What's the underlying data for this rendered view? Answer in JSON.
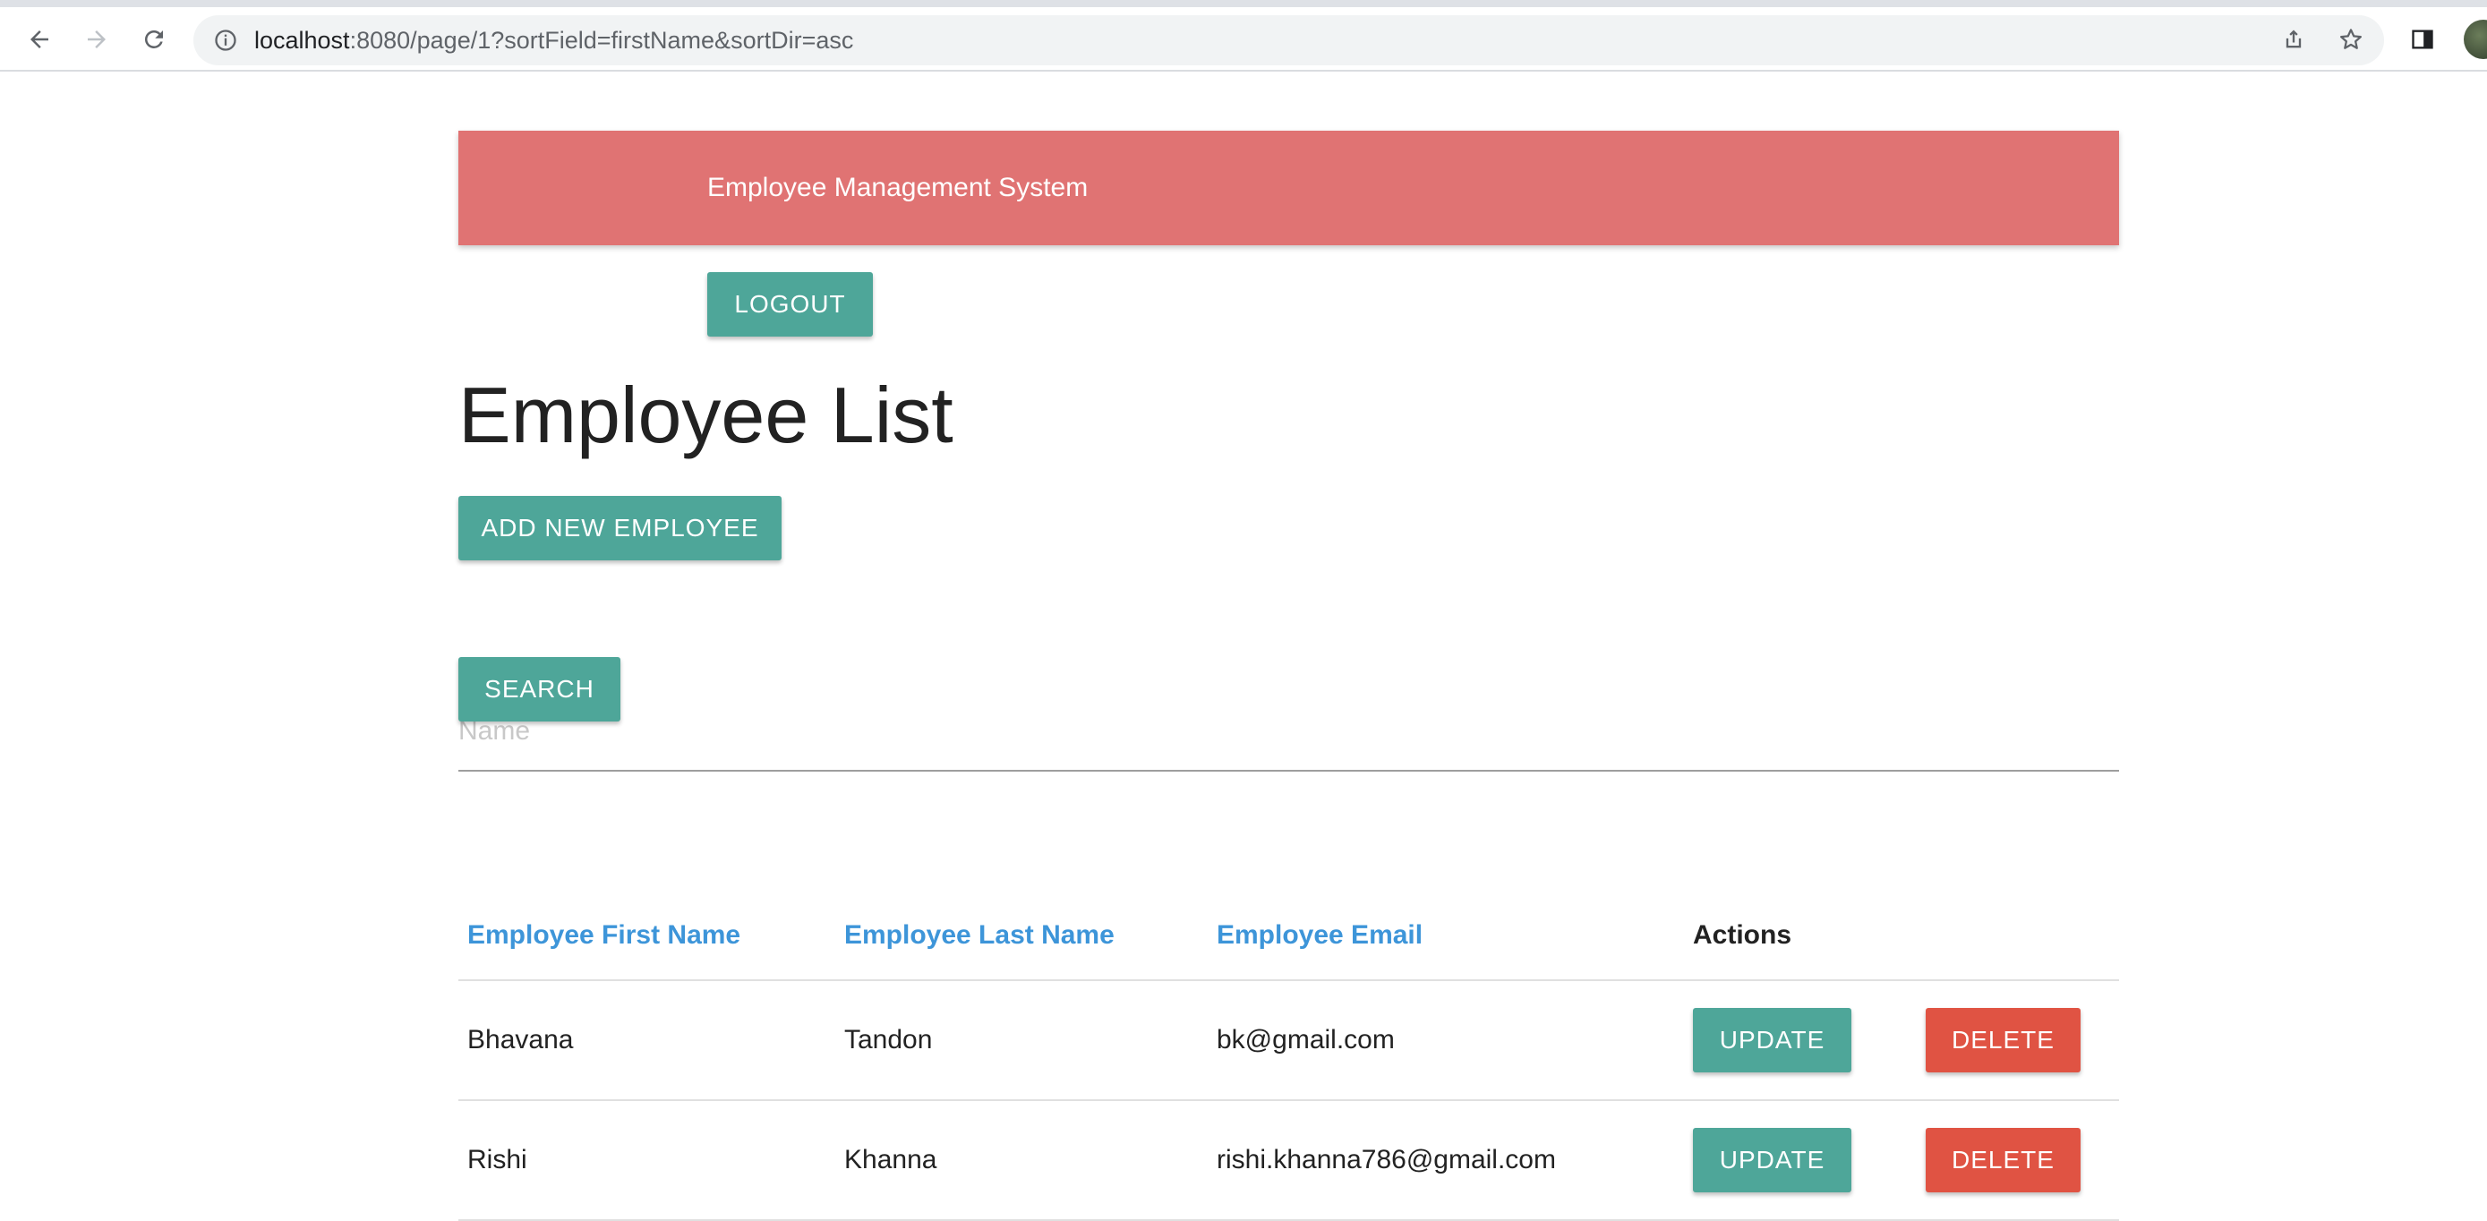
{
  "browser": {
    "url_host": "localhost",
    "url_rest": ":8080/page/1?sortField=firstName&sortDir=asc",
    "icons": [
      "back-arrow-icon",
      "forward-arrow-icon",
      "reload-icon",
      "info-icon",
      "share-icon",
      "star-icon",
      "side-panel-icon"
    ]
  },
  "navbar": {
    "brand": "Employee Management System"
  },
  "auth": {
    "logout_label": "LOGOUT"
  },
  "page": {
    "title": "Employee List",
    "add_button_label": "ADD NEW EMPLOYEE",
    "search_placeholder": "Name",
    "search_value": "",
    "search_button_label": "SEARCH"
  },
  "table": {
    "headers": {
      "first_name": "Employee First Name",
      "last_name": "Employee Last Name",
      "email": "Employee Email",
      "actions": "Actions"
    },
    "rows": [
      {
        "first_name": "Bhavana",
        "last_name": "Tandon",
        "email": "bk@gmail.com",
        "update_label": "UPDATE",
        "delete_label": "DELETE"
      },
      {
        "first_name": "Rishi",
        "last_name": "Khanna",
        "email": "rishi.khanna786@gmail.com",
        "update_label": "UPDATE",
        "delete_label": "DELETE"
      }
    ]
  },
  "colors": {
    "navbar": "#e07373",
    "primary_button": "#4ea699",
    "danger_button": "#e05343",
    "header_link": "#3d95d9"
  }
}
